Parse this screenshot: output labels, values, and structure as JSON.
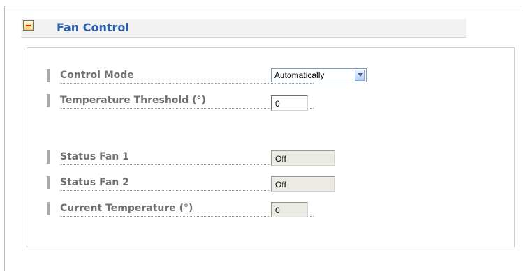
{
  "section": {
    "title": "Fan Control"
  },
  "fields": {
    "control_mode": {
      "label": "Control Mode",
      "value": "Automatically"
    },
    "temperature_threshold": {
      "label": "Temperature Threshold (°)",
      "value": "0"
    },
    "status_fan_1": {
      "label": "Status Fan 1",
      "value": "Off"
    },
    "status_fan_2": {
      "label": "Status Fan 2",
      "value": "Off"
    },
    "current_temperature": {
      "label": "Current Temperature (°)",
      "value": "0"
    }
  },
  "colors": {
    "title": "#2b61b0",
    "label": "#707070",
    "bar": "#a9a9a9",
    "collapse_minus": "#d01414"
  },
  "icons": {
    "collapse": "collapse-minus-icon",
    "dropdown": "chevron-down-icon"
  }
}
